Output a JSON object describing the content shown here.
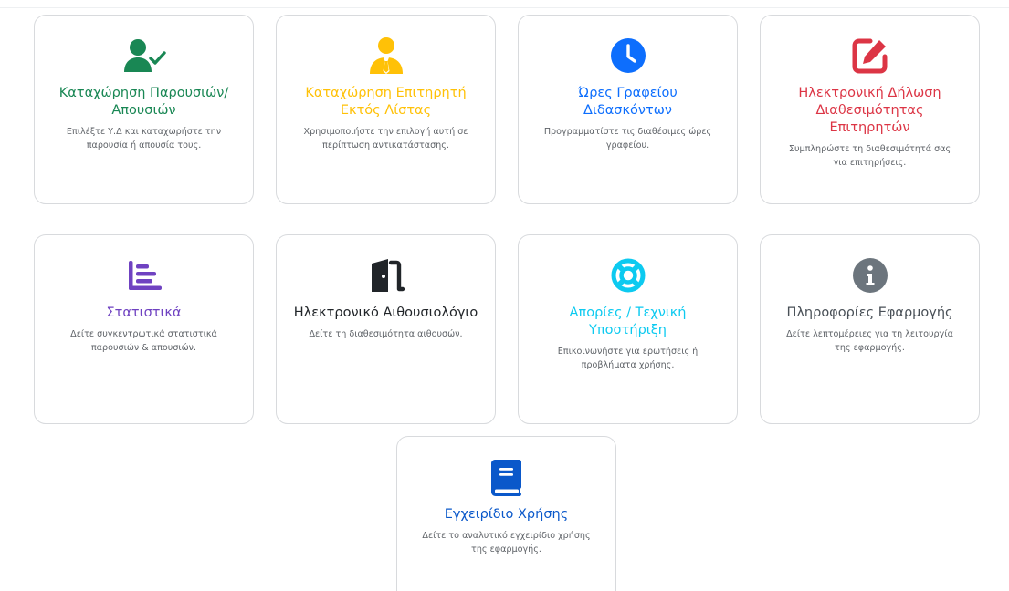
{
  "cards": [
    {
      "title": "Καταχώρηση Παρουσιών/Απουσιών",
      "desc": "Επιλέξτε Υ.Δ και καταχωρήστε την παρουσία ή απουσία τους.",
      "color": "#198754",
      "icon": "user-check-icon"
    },
    {
      "title": "Καταχώρηση Επιτηρητή Εκτός Λίστας",
      "desc": "Χρησιμοποιήστε την επιλογή αυτή σε περίπτωση αντικατάστασης.",
      "color": "#ffc107",
      "icon": "user-tie-icon"
    },
    {
      "title": "Ώρες Γραφείου Διδασκόντων",
      "desc": "Προγραμματίστε τις διαθέσιμες ώρες γραφείου.",
      "color": "#0d6efd",
      "icon": "clock-icon"
    },
    {
      "title": "Ηλεκτρονική Δήλωση Διαθεσιμότητας Επιτηρητών",
      "desc": "Συμπληρώστε τη διαθεσιμότητά σας για επιτηρήσεις.",
      "color": "#dc3545",
      "icon": "edit-square-icon"
    },
    {
      "title": "Στατιστικά",
      "desc": "Δείτε συγκεντρωτικά στατιστικά παρουσιών & απουσιών.",
      "color": "#6f42c1",
      "icon": "chart-simple-icon"
    },
    {
      "title": "Ηλεκτρονικό Αιθουσιολόγιο",
      "desc": "Δείτε τη διαθεσιμότητα αιθουσών.",
      "color": "#212529",
      "icon": "door-open-icon"
    },
    {
      "title": "Απορίες / Τεχνική Υποστήριξη",
      "desc": "Επικοινωνήστε για ερωτήσεις ή προβλήματα χρήσης.",
      "color": "#0dcaf0",
      "icon": "life-ring-icon"
    },
    {
      "title": "Πληροφορίες Εφαρμογής",
      "desc": "Δείτε λεπτομέρειες για τη λειτουργία της εφαρμογής.",
      "color": "#6c757d",
      "icon": "info-circle-icon"
    },
    {
      "title": "Εγχειρίδιο Χρήσης",
      "desc": "Δείτε το αναλυτικό εγχειρίδιο χρήσης της εφαρμογής.",
      "color": "#0a58ca",
      "icon": "book-icon"
    }
  ]
}
